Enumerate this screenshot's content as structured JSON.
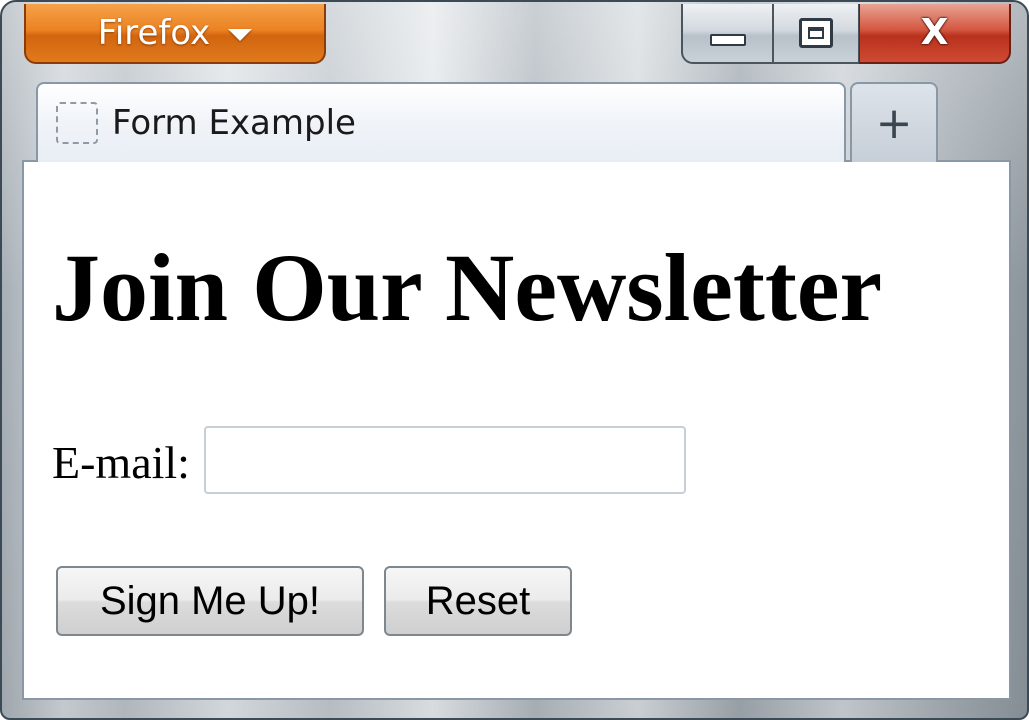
{
  "window": {
    "app_button_label": "Firefox",
    "minimize_icon": "minimize-icon",
    "maximize_icon": "maximize-icon",
    "close_label": "X"
  },
  "tabs": [
    {
      "title": "Form Example",
      "favicon": "blank-page-icon"
    }
  ],
  "new_tab_label": "+",
  "page": {
    "heading": "Join Our Newsletter",
    "email_label": "E-mail:",
    "email_value": "",
    "submit_label": "Sign Me Up!",
    "reset_label": "Reset"
  },
  "colors": {
    "app_button": "#e8801f",
    "close_button": "#c8402a",
    "tab_background": "#eef2f8"
  }
}
